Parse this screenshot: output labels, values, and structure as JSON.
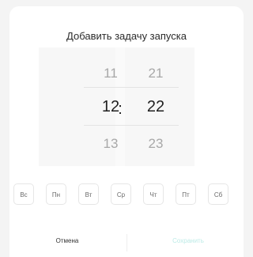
{
  "dialog": {
    "title": "Добавить задачу запуска"
  },
  "time_picker": {
    "hours": {
      "above": "11",
      "selected": "12",
      "below": "13"
    },
    "separator": ":",
    "minutes": {
      "above": "21",
      "selected": "22",
      "below": "23"
    }
  },
  "weekdays": [
    {
      "label": "Вс"
    },
    {
      "label": "Пн"
    },
    {
      "label": "Вт"
    },
    {
      "label": "Ср"
    },
    {
      "label": "Чт"
    },
    {
      "label": "Пт"
    },
    {
      "label": "Сб"
    }
  ],
  "footer": {
    "cancel_label": "Отмена",
    "save_label": "Сохранить"
  },
  "colors": {
    "save_disabled": "#bdebe7",
    "background": "#f4f4f4"
  }
}
